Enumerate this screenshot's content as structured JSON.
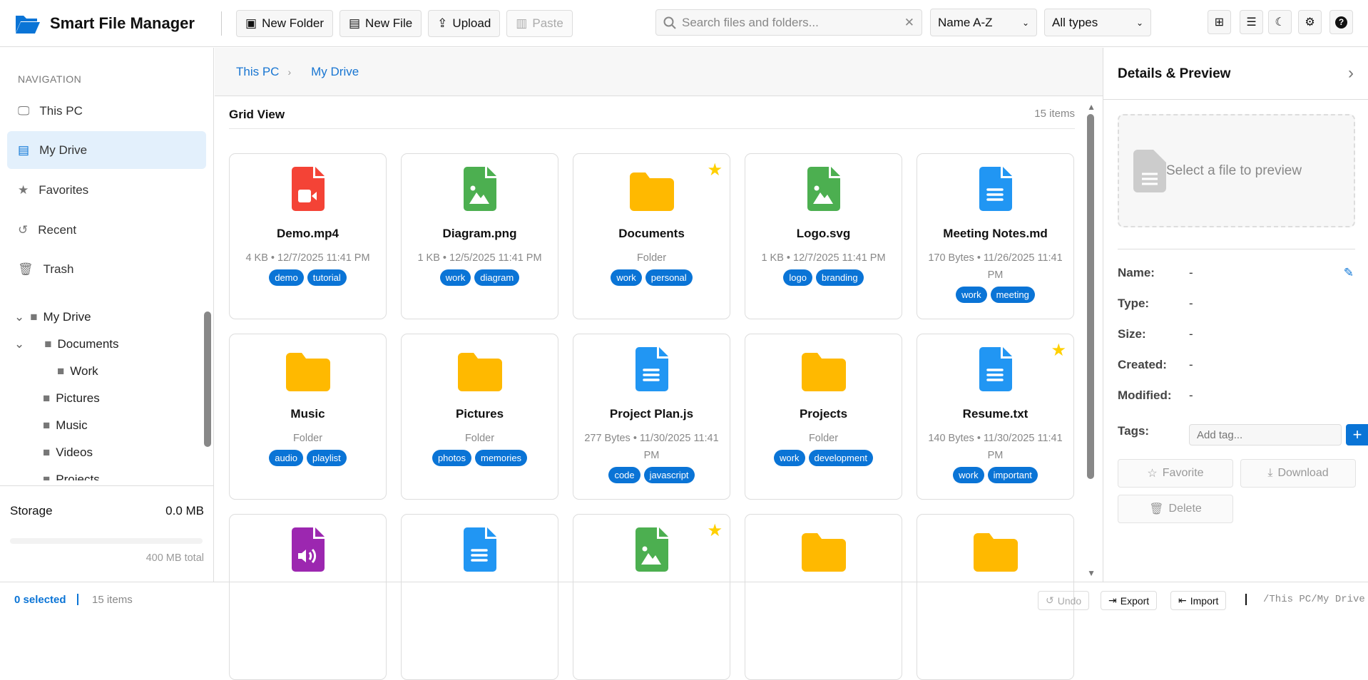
{
  "app": {
    "title": "Smart File Manager"
  },
  "toolbar": {
    "new_folder": "New Folder",
    "new_file": "New File",
    "upload": "Upload",
    "paste": "Paste",
    "search_placeholder": "Search files and folders...",
    "sort": "Name A-Z",
    "filter": "All types"
  },
  "sidebar": {
    "heading": "NAVIGATION",
    "items": [
      {
        "label": "This PC"
      },
      {
        "label": "My Drive"
      },
      {
        "label": "Favorites"
      },
      {
        "label": "Recent"
      },
      {
        "label": "Trash"
      }
    ],
    "tree": [
      "My Drive",
      "Documents",
      "Work",
      "Pictures",
      "Music",
      "Videos",
      "Projects"
    ],
    "storage": {
      "label": "Storage",
      "used": "0.0 MB",
      "total": "400 MB total",
      "fraction": 0
    }
  },
  "breadcrumb": [
    "This PC",
    "My Drive"
  ],
  "grid": {
    "title": "Grid View",
    "count": "15 items",
    "items": [
      {
        "name": "Demo.mp4",
        "meta": "4 KB • 12/7/2025 11:41 PM",
        "tags": [
          "demo",
          "tutorial"
        ],
        "kind": "video",
        "color": "#f44336",
        "star": false
      },
      {
        "name": "Diagram.png",
        "meta": "1 KB • 12/5/2025 11:41 PM",
        "tags": [
          "work",
          "diagram"
        ],
        "kind": "image",
        "color": "#4caf50",
        "star": false
      },
      {
        "name": "Documents",
        "meta": "Folder",
        "tags": [
          "work",
          "personal"
        ],
        "kind": "folder",
        "color": "#ffb900",
        "star": true
      },
      {
        "name": "Logo.svg",
        "meta": "1 KB • 12/7/2025 11:41 PM",
        "tags": [
          "logo",
          "branding"
        ],
        "kind": "image",
        "color": "#4caf50",
        "star": false
      },
      {
        "name": "Meeting Notes.md",
        "meta": "170 Bytes • 11/26/2025 11:41 PM",
        "tags": [
          "work",
          "meeting"
        ],
        "kind": "text",
        "color": "#2196f3",
        "star": false
      },
      {
        "name": "Music",
        "meta": "Folder",
        "tags": [
          "audio",
          "playlist"
        ],
        "kind": "folder",
        "color": "#ffb900",
        "star": false
      },
      {
        "name": "Pictures",
        "meta": "Folder",
        "tags": [
          "photos",
          "memories"
        ],
        "kind": "folder",
        "color": "#ffb900",
        "star": false
      },
      {
        "name": "Project Plan.js",
        "meta": "277 Bytes • 11/30/2025 11:41 PM",
        "tags": [
          "code",
          "javascript"
        ],
        "kind": "text",
        "color": "#2196f3",
        "star": false
      },
      {
        "name": "Projects",
        "meta": "Folder",
        "tags": [
          "work",
          "development"
        ],
        "kind": "folder",
        "color": "#ffb900",
        "star": false
      },
      {
        "name": "Resume.txt",
        "meta": "140 Bytes • 11/30/2025 11:41 PM",
        "tags": [
          "work",
          "important"
        ],
        "kind": "text",
        "color": "#2196f3",
        "star": true
      },
      {
        "name": "",
        "meta": "",
        "tags": [],
        "kind": "audio",
        "color": "#9c27b0",
        "star": false
      },
      {
        "name": "",
        "meta": "",
        "tags": [],
        "kind": "text",
        "color": "#2196f3",
        "star": false
      },
      {
        "name": "",
        "meta": "",
        "tags": [],
        "kind": "image",
        "color": "#4caf50",
        "star": true
      },
      {
        "name": "",
        "meta": "",
        "tags": [],
        "kind": "folder",
        "color": "#ffb900",
        "star": false
      },
      {
        "name": "",
        "meta": "",
        "tags": [],
        "kind": "folder",
        "color": "#ffb900",
        "star": false
      }
    ]
  },
  "details": {
    "title": "Details & Preview",
    "preview_text": "Select a file to preview",
    "fields": [
      {
        "label": "Name:",
        "value": "-"
      },
      {
        "label": "Type:",
        "value": "-"
      },
      {
        "label": "Size:",
        "value": "-"
      },
      {
        "label": "Created:",
        "value": "-"
      },
      {
        "label": "Modified:",
        "value": "-"
      }
    ],
    "tags_label": "Tags:",
    "tag_placeholder": "Add tag...",
    "favorite": "Favorite",
    "download": "Download",
    "delete": "Delete"
  },
  "footer": {
    "selected": "0 selected",
    "items": "15 items",
    "undo": "Undo",
    "export": "Export",
    "import": "Import",
    "path": "/This PC/My Drive"
  }
}
